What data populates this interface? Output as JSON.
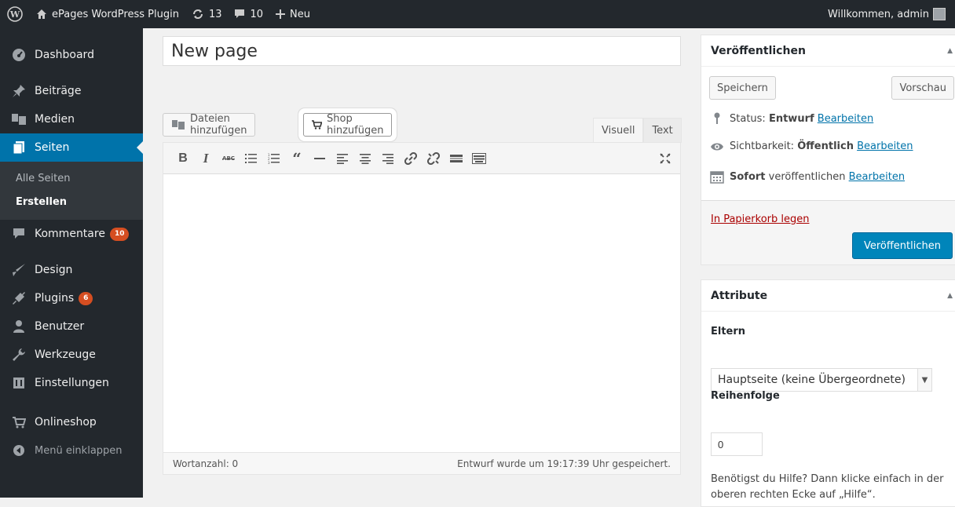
{
  "adminbar": {
    "site_name": "ePages WordPress Plugin",
    "updates_count": "13",
    "comments_count": "10",
    "new_label": "Neu",
    "welcome": "Willkommen, admin"
  },
  "sidebar": {
    "items": [
      {
        "label": "Dashboard",
        "icon": "dashboard-icon"
      },
      {
        "label": "Beiträge",
        "icon": "pin-icon"
      },
      {
        "label": "Medien",
        "icon": "media-icon"
      },
      {
        "label": "Seiten",
        "icon": "pages-icon"
      },
      {
        "label": "Kommentare",
        "icon": "comments-icon",
        "badge": "10"
      },
      {
        "label": "Design",
        "icon": "brush-icon"
      },
      {
        "label": "Plugins",
        "icon": "plugin-icon",
        "badge": "6"
      },
      {
        "label": "Benutzer",
        "icon": "users-icon"
      },
      {
        "label": "Werkzeuge",
        "icon": "wrench-icon"
      },
      {
        "label": "Einstellungen",
        "icon": "settings-icon"
      },
      {
        "label": "Onlineshop",
        "icon": "cart-icon"
      }
    ],
    "submenu": [
      "Alle Seiten",
      "Erstellen"
    ],
    "collapse_label": "Menü einklappen"
  },
  "editor": {
    "title_value": "New page",
    "add_media_label": "Dateien hinzufügen",
    "add_shop_label": "Shop hinzufügen",
    "tab_visual": "Visuell",
    "tab_text": "Text",
    "word_count": "Wortanzahl: 0",
    "autosave_status": "Entwurf wurde um 19:17:39 Uhr gespeichert."
  },
  "publish_box": {
    "title": "Veröffentlichen",
    "save_label": "Speichern",
    "preview_label": "Vorschau",
    "status_label": "Status:",
    "status_value": "Entwurf",
    "visibility_label": "Sichtbarkeit:",
    "visibility_value": "Öffentlich",
    "schedule_value": "Sofort",
    "schedule_label": "veröffentlichen",
    "edit_link": "Bearbeiten",
    "trash_label": "In Papierkorb legen",
    "publish_label": "Veröffentlichen"
  },
  "attributes_box": {
    "title": "Attribute",
    "parent_label": "Eltern",
    "parent_selected": "Hauptseite (keine Übergeordnete)",
    "order_label": "Reihenfolge",
    "order_value": "0",
    "help_text": "Benötigst du Hilfe? Dann klicke einfach in der oberen rechten Ecke auf „Hilfe“."
  },
  "colors": {
    "admin_dark": "#23282d",
    "accent_blue": "#0073aa",
    "publish_blue": "#0085ba",
    "badge_orange": "#d54e21",
    "trash_red": "#a00"
  }
}
